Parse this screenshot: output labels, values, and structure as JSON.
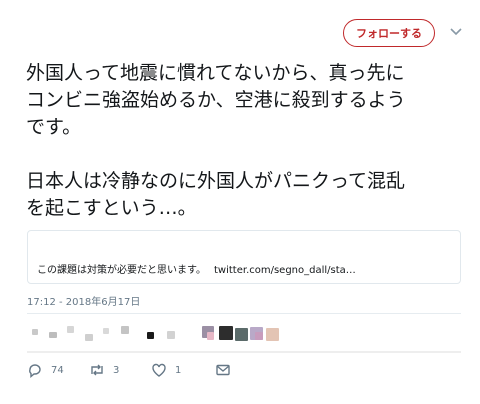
{
  "header": {
    "follow_label": "フォローする",
    "menu_icon": "chevron-down-icon"
  },
  "tweet": {
    "paragraphs": [
      "外国人って地震に慣れてないから、真っ先に\nコンビニ強盗始めるか、空港に殺到するよう\nです。",
      "日本人は冷静なのに外国人がパニクって混乱\nを起こすという…。"
    ],
    "card_text": "この課題は対策が必要だと思います。",
    "card_link": "twitter.com/segno_dall/sta…",
    "timestamp": "17:12 - 2018年6月17日"
  },
  "actions": {
    "reply_count": "74",
    "retweet_count": "3",
    "like_count": "1"
  },
  "colors": {
    "accent": "#c0292b",
    "muted": "#657786",
    "border": "#e1e8ed",
    "text": "#14171a"
  }
}
